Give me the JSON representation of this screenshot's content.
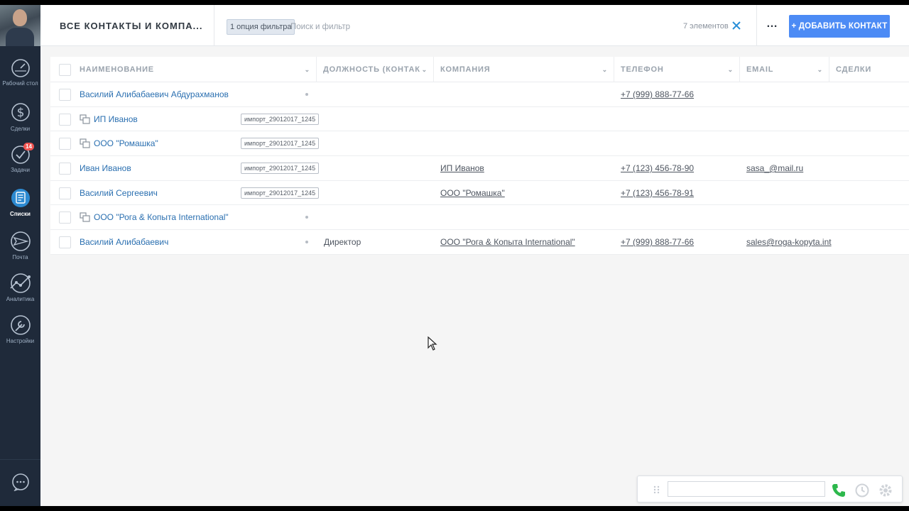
{
  "sidebar": {
    "items": [
      {
        "label": "Рабочий стол",
        "icon": "dashboard-icon"
      },
      {
        "label": "Сделки",
        "icon": "dollar-icon"
      },
      {
        "label": "Задачи",
        "icon": "check-circle-icon",
        "badge": "14"
      },
      {
        "label": "Списки",
        "icon": "lists-icon",
        "active": true
      },
      {
        "label": "Почта",
        "icon": "mail-icon"
      },
      {
        "label": "Аналитика",
        "icon": "analytics-icon"
      },
      {
        "label": "Настройки",
        "icon": "wrench-icon"
      }
    ],
    "chat_icon": "chat-icon"
  },
  "header": {
    "title": "ВСЕ КОНТАКТЫ И КОМПА...",
    "filter_chip": "1 опция фильтра",
    "search_placeholder": "Поиск и фильтр",
    "count": "7 элементов",
    "more": "…",
    "add_button": "+ ДОБАВИТЬ КОНТАКТ"
  },
  "table": {
    "columns": [
      "НАИМЕНОВАНИЕ",
      "ДОЛЖНОСТЬ (КОНТАК",
      "КОМПАНИЯ",
      "ТЕЛЕФОН",
      "EMAIL",
      "СДЕЛКИ"
    ],
    "rows": [
      {
        "name": "Василий Алибабаевич Абдурахманов",
        "is_company": false,
        "tag": "",
        "position": "",
        "company": "",
        "phone": "+7 (999) 888-77-66",
        "email": ""
      },
      {
        "name": "ИП Иванов",
        "is_company": true,
        "tag": "импорт_29012017_1245",
        "position": "",
        "company": "",
        "phone": "",
        "email": ""
      },
      {
        "name": "ООО \"Ромашка\"",
        "is_company": true,
        "tag": "импорт_29012017_1245",
        "position": "",
        "company": "",
        "phone": "",
        "email": ""
      },
      {
        "name": "Иван Иванов",
        "is_company": false,
        "tag": "импорт_29012017_1245",
        "position": "",
        "company": "ИП Иванов",
        "phone": "+7 (123) 456-78-90",
        "email": "sasa_@mail.ru"
      },
      {
        "name": "Василий Сергеевич",
        "is_company": false,
        "tag": "импорт_29012017_1245",
        "position": "",
        "company": "ООО \"Ромашка\"",
        "phone": "+7 (123) 456-78-91",
        "email": ""
      },
      {
        "name": "ООО \"Рога & Копыта International\"",
        "is_company": true,
        "tag": "",
        "position": "",
        "company": "",
        "phone": "",
        "email": ""
      },
      {
        "name": "Василий Алибабаевич",
        "is_company": false,
        "tag": "",
        "position": "Директор",
        "company": "ООО \"Рога & Копыта International\"",
        "phone": "+7 (999) 888-77-66",
        "email": "sales@roga-kopyta.int"
      }
    ]
  },
  "colors": {
    "sidebar": "#1f2a3a",
    "accent": "#4c8bf5",
    "link": "#2a6fb0",
    "badge": "#ef5350",
    "call": "#2db84c"
  }
}
